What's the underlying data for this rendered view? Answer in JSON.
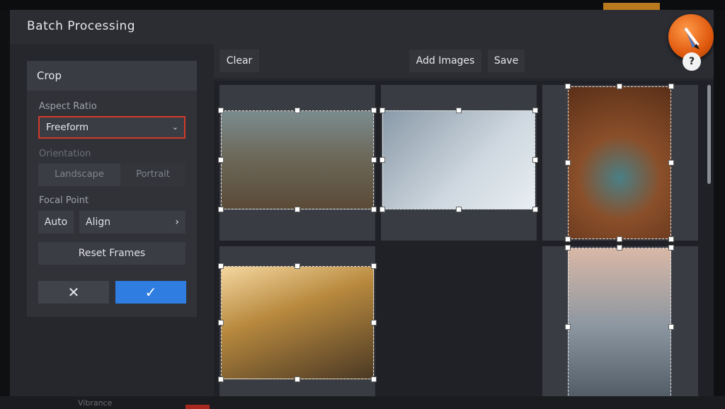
{
  "window": {
    "title": "Batch Processing"
  },
  "crop_panel": {
    "header": "Crop",
    "aspect_ratio_label": "Aspect Ratio",
    "aspect_ratio_value": "Freeform",
    "orientation_label": "Orientation",
    "orientation_options": [
      "Landscape",
      "Portrait"
    ],
    "focal_point_label": "Focal Point",
    "focal_auto": "Auto",
    "focal_align": "Align",
    "reset_label": "Reset Frames",
    "cancel_icon": "close-icon",
    "confirm_icon": "check-icon"
  },
  "toolbar": {
    "clear": "Clear",
    "add_images": "Add Images",
    "save": "Save"
  },
  "help": {
    "label": "?"
  },
  "bottom": {
    "text": "Vibrance"
  },
  "colors": {
    "accent": "#2f7de1",
    "highlight": "#d23a2a",
    "background": "#2b2d33"
  }
}
